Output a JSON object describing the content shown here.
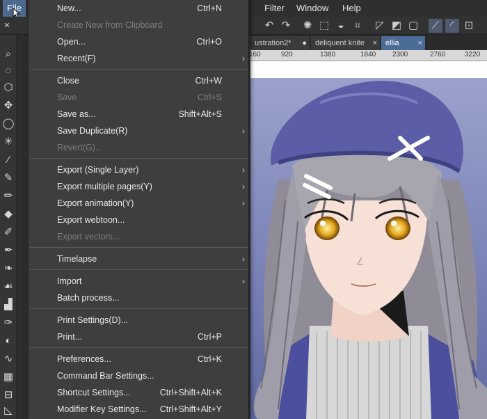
{
  "menubar": {
    "file": "File",
    "filter": "Filter",
    "window": "Window",
    "help": "Help"
  },
  "tabs": [
    {
      "label": "ustration2*",
      "close": "●"
    },
    {
      "label": "deliquent knite",
      "close": "×"
    },
    {
      "label": "ellia",
      "close": "×"
    }
  ],
  "ruler": [
    "160",
    "920",
    "1380",
    "1840",
    "2300",
    "2760",
    "3220"
  ],
  "file_menu": {
    "items": [
      {
        "label": "New...",
        "shortcut": "Ctrl+N"
      },
      {
        "label": "Create New from Clipboard",
        "disabled": true
      },
      {
        "label": "Open...",
        "shortcut": "Ctrl+O"
      },
      {
        "label": "Recent(F)",
        "arrow": "›"
      },
      {
        "label": "Close",
        "shortcut": "Ctrl+W"
      },
      {
        "label": "Save",
        "shortcut": "Ctrl+S",
        "disabled": true
      },
      {
        "label": "Save as...",
        "shortcut": "Shift+Alt+S"
      },
      {
        "label": "Save Duplicate(R)",
        "arrow": "›"
      },
      {
        "label": "Revert(G)...",
        "disabled": true
      },
      {
        "label": "Export (Single Layer)",
        "arrow": "›"
      },
      {
        "label": "Export multiple pages(Y)",
        "arrow": "›"
      },
      {
        "label": "Export animation(Y)",
        "arrow": "›"
      },
      {
        "label": "Export webtoon..."
      },
      {
        "label": "Export vectors...",
        "disabled": true
      },
      {
        "label": "Timelapse",
        "arrow": "›"
      },
      {
        "label": "Import",
        "arrow": "›"
      },
      {
        "label": "Batch process..."
      },
      {
        "label": "Print Settings(D)..."
      },
      {
        "label": "Print...",
        "shortcut": "Ctrl+P"
      },
      {
        "label": "Preferences...",
        "shortcut": "Ctrl+K"
      },
      {
        "label": "Command Bar Settings..."
      },
      {
        "label": "Shortcut Settings...",
        "shortcut": "Ctrl+Shift+Alt+K"
      },
      {
        "label": "Modifier Key Settings...",
        "shortcut": "Ctrl+Shift+Alt+Y"
      }
    ]
  },
  "colors": {
    "menu_bg": "#3e3e3e",
    "highlight": "#4d6a8e",
    "active_tab": "#4c6c98",
    "beret": "#5b5ea6",
    "hair": "#9c9aa3",
    "eye": "#d9a21b",
    "skin": "#f6ded3",
    "sky": "#7b86b8"
  }
}
